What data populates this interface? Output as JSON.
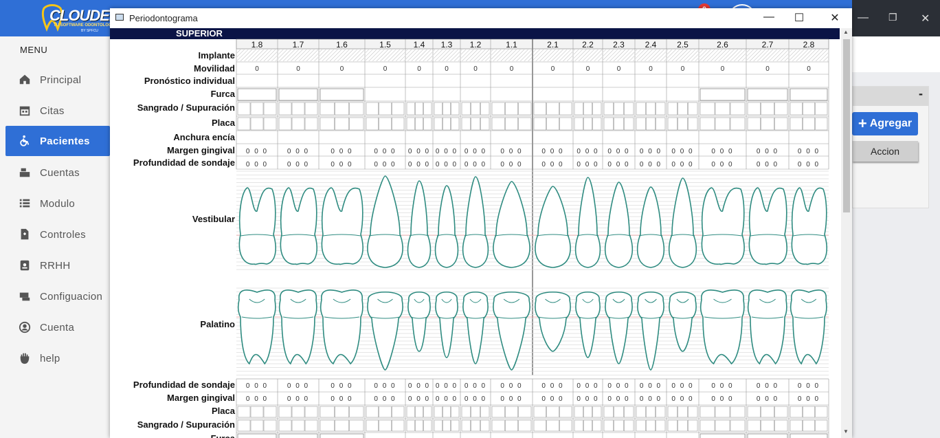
{
  "app": {
    "logo_text": "CLOUDEN",
    "logo_tagline": "TU SOFTWARE ODONTOLOG",
    "logo_by": "BY SPFCU",
    "notification_count": "0"
  },
  "sidebar": {
    "menu_title": "MENU",
    "items": [
      {
        "label": "Principal",
        "icon": "home-icon"
      },
      {
        "label": "Citas",
        "icon": "calendar-icon"
      },
      {
        "label": "Pacientes",
        "icon": "wheelchair-icon",
        "active": true
      },
      {
        "label": "Cuentas",
        "icon": "cash-register-icon"
      },
      {
        "label": "Modulo",
        "icon": "list-icon"
      },
      {
        "label": "Controles",
        "icon": "file-medical-icon"
      },
      {
        "label": "RRHH",
        "icon": "id-badge-icon"
      },
      {
        "label": "Configuacion",
        "icon": "tools-icon"
      },
      {
        "label": "Cuenta",
        "icon": "user-circle-icon"
      },
      {
        "label": "help",
        "icon": "hand-icon"
      }
    ]
  },
  "right_panel": {
    "collapse_label": "-",
    "add_button": "Agregar",
    "action_button": "Accion"
  },
  "window": {
    "title": "Periodontograma",
    "minimize": "—",
    "maximize": "☐",
    "close": "✕"
  },
  "periodontogram": {
    "section_title": "SUPERIOR",
    "teeth": [
      "1.8",
      "1.7",
      "1.6",
      "1.5",
      "1.4",
      "1.3",
      "1.2",
      "1.1",
      "2.1",
      "2.2",
      "2.3",
      "2.4",
      "2.5",
      "2.6",
      "2.7",
      "2.8"
    ],
    "upper_rows": [
      "Implante",
      "Movilidad",
      "Pronóstico individual",
      "Furca",
      "Sangrado / Supuración",
      "Placa",
      "Anchura encía",
      "Margen gingival",
      "Profundidad de sondaje"
    ],
    "vestibular_label": "Vestibular",
    "palatino_label": "Palatino",
    "lower_rows": [
      "Profundidad de sondaje",
      "Margen gingival",
      "Placa",
      "Sangrado / Supuración",
      "Furca"
    ],
    "mobility_value": "0",
    "measure_value": "0 0 0"
  }
}
